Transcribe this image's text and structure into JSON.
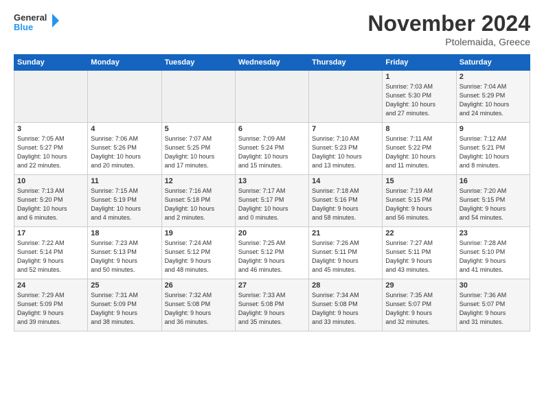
{
  "logo": {
    "line1": "General",
    "line2": "Blue"
  },
  "title": "November 2024",
  "location": "Ptolemaida, Greece",
  "days_of_week": [
    "Sunday",
    "Monday",
    "Tuesday",
    "Wednesday",
    "Thursday",
    "Friday",
    "Saturday"
  ],
  "weeks": [
    [
      {
        "num": "",
        "info": ""
      },
      {
        "num": "",
        "info": ""
      },
      {
        "num": "",
        "info": ""
      },
      {
        "num": "",
        "info": ""
      },
      {
        "num": "",
        "info": ""
      },
      {
        "num": "1",
        "info": "Sunrise: 7:03 AM\nSunset: 5:30 PM\nDaylight: 10 hours\nand 27 minutes."
      },
      {
        "num": "2",
        "info": "Sunrise: 7:04 AM\nSunset: 5:29 PM\nDaylight: 10 hours\nand 24 minutes."
      }
    ],
    [
      {
        "num": "3",
        "info": "Sunrise: 7:05 AM\nSunset: 5:27 PM\nDaylight: 10 hours\nand 22 minutes."
      },
      {
        "num": "4",
        "info": "Sunrise: 7:06 AM\nSunset: 5:26 PM\nDaylight: 10 hours\nand 20 minutes."
      },
      {
        "num": "5",
        "info": "Sunrise: 7:07 AM\nSunset: 5:25 PM\nDaylight: 10 hours\nand 17 minutes."
      },
      {
        "num": "6",
        "info": "Sunrise: 7:09 AM\nSunset: 5:24 PM\nDaylight: 10 hours\nand 15 minutes."
      },
      {
        "num": "7",
        "info": "Sunrise: 7:10 AM\nSunset: 5:23 PM\nDaylight: 10 hours\nand 13 minutes."
      },
      {
        "num": "8",
        "info": "Sunrise: 7:11 AM\nSunset: 5:22 PM\nDaylight: 10 hours\nand 11 minutes."
      },
      {
        "num": "9",
        "info": "Sunrise: 7:12 AM\nSunset: 5:21 PM\nDaylight: 10 hours\nand 8 minutes."
      }
    ],
    [
      {
        "num": "10",
        "info": "Sunrise: 7:13 AM\nSunset: 5:20 PM\nDaylight: 10 hours\nand 6 minutes."
      },
      {
        "num": "11",
        "info": "Sunrise: 7:15 AM\nSunset: 5:19 PM\nDaylight: 10 hours\nand 4 minutes."
      },
      {
        "num": "12",
        "info": "Sunrise: 7:16 AM\nSunset: 5:18 PM\nDaylight: 10 hours\nand 2 minutes."
      },
      {
        "num": "13",
        "info": "Sunrise: 7:17 AM\nSunset: 5:17 PM\nDaylight: 10 hours\nand 0 minutes."
      },
      {
        "num": "14",
        "info": "Sunrise: 7:18 AM\nSunset: 5:16 PM\nDaylight: 9 hours\nand 58 minutes."
      },
      {
        "num": "15",
        "info": "Sunrise: 7:19 AM\nSunset: 5:15 PM\nDaylight: 9 hours\nand 56 minutes."
      },
      {
        "num": "16",
        "info": "Sunrise: 7:20 AM\nSunset: 5:15 PM\nDaylight: 9 hours\nand 54 minutes."
      }
    ],
    [
      {
        "num": "17",
        "info": "Sunrise: 7:22 AM\nSunset: 5:14 PM\nDaylight: 9 hours\nand 52 minutes."
      },
      {
        "num": "18",
        "info": "Sunrise: 7:23 AM\nSunset: 5:13 PM\nDaylight: 9 hours\nand 50 minutes."
      },
      {
        "num": "19",
        "info": "Sunrise: 7:24 AM\nSunset: 5:12 PM\nDaylight: 9 hours\nand 48 minutes."
      },
      {
        "num": "20",
        "info": "Sunrise: 7:25 AM\nSunset: 5:12 PM\nDaylight: 9 hours\nand 46 minutes."
      },
      {
        "num": "21",
        "info": "Sunrise: 7:26 AM\nSunset: 5:11 PM\nDaylight: 9 hours\nand 45 minutes."
      },
      {
        "num": "22",
        "info": "Sunrise: 7:27 AM\nSunset: 5:11 PM\nDaylight: 9 hours\nand 43 minutes."
      },
      {
        "num": "23",
        "info": "Sunrise: 7:28 AM\nSunset: 5:10 PM\nDaylight: 9 hours\nand 41 minutes."
      }
    ],
    [
      {
        "num": "24",
        "info": "Sunrise: 7:29 AM\nSunset: 5:09 PM\nDaylight: 9 hours\nand 39 minutes."
      },
      {
        "num": "25",
        "info": "Sunrise: 7:31 AM\nSunset: 5:09 PM\nDaylight: 9 hours\nand 38 minutes."
      },
      {
        "num": "26",
        "info": "Sunrise: 7:32 AM\nSunset: 5:08 PM\nDaylight: 9 hours\nand 36 minutes."
      },
      {
        "num": "27",
        "info": "Sunrise: 7:33 AM\nSunset: 5:08 PM\nDaylight: 9 hours\nand 35 minutes."
      },
      {
        "num": "28",
        "info": "Sunrise: 7:34 AM\nSunset: 5:08 PM\nDaylight: 9 hours\nand 33 minutes."
      },
      {
        "num": "29",
        "info": "Sunrise: 7:35 AM\nSunset: 5:07 PM\nDaylight: 9 hours\nand 32 minutes."
      },
      {
        "num": "30",
        "info": "Sunrise: 7:36 AM\nSunset: 5:07 PM\nDaylight: 9 hours\nand 31 minutes."
      }
    ]
  ]
}
